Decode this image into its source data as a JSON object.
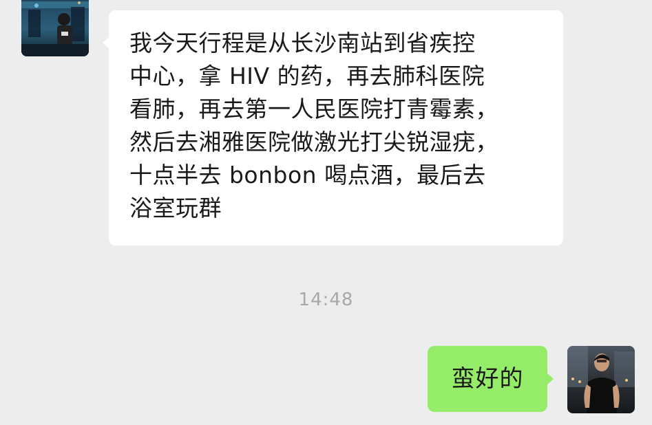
{
  "contact": {
    "name": "",
    "avatar_icon": "contact-avatar-photo"
  },
  "incoming": {
    "lines": [
      "我今天行程是从长沙南站到省疾控",
      "中心，拿 HIV 的药，再去肺科医院",
      "看肺，再去第一人民医院打青霉素，",
      "然后去湘雅医院做激光打尖锐湿疣，",
      "十点半去 bonbon 喝点酒，最后去",
      "浴室玩群"
    ],
    "bubble_color": "#ffffff"
  },
  "timestamp": "14:48",
  "outgoing": {
    "text": "蛮好的",
    "bubble_color": "#95ec69",
    "avatar_icon": "self-avatar-photo"
  },
  "colors": {
    "background": "#ededed",
    "text": "#191919",
    "timestamp": "#a8a8a8"
  }
}
